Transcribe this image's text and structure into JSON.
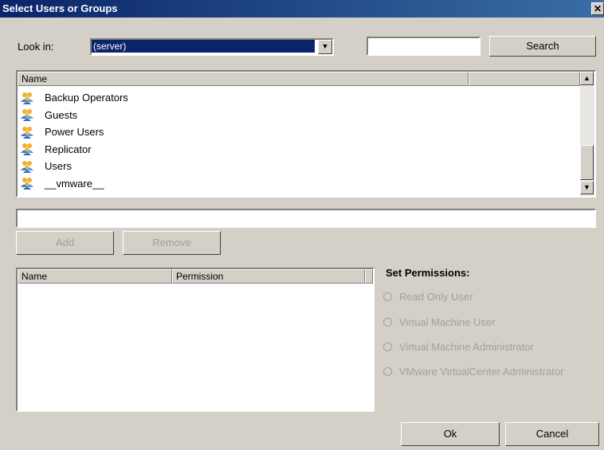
{
  "window": {
    "title": "Select Users or Groups",
    "close": "✕"
  },
  "lookin": {
    "label": "Look in:",
    "selected": "(server)"
  },
  "search": {
    "value": "",
    "button": "Search"
  },
  "groups_list": {
    "headers": [
      "Name",
      ""
    ],
    "items": [
      {
        "name": "Backup Operators",
        "icon": "user-group-icon"
      },
      {
        "name": "Guests",
        "icon": "user-group-icon"
      },
      {
        "name": "Power Users",
        "icon": "user-group-icon"
      },
      {
        "name": "Replicator",
        "icon": "user-group-icon"
      },
      {
        "name": "Users",
        "icon": "user-group-icon"
      },
      {
        "name": "__vmware__",
        "icon": "user-group-icon"
      }
    ]
  },
  "name_field": {
    "value": ""
  },
  "buttons": {
    "add": "Add",
    "remove": "Remove",
    "ok": "Ok",
    "cancel": "Cancel"
  },
  "permissions_list": {
    "headers": [
      "Name",
      "Permission",
      ""
    ]
  },
  "permissions": {
    "title": "Set Permissions:",
    "options": [
      "Read Only User",
      "Virtual Machine User",
      "Virtual Machine Administrator",
      "VMware VirtualCenter Administrator"
    ]
  }
}
